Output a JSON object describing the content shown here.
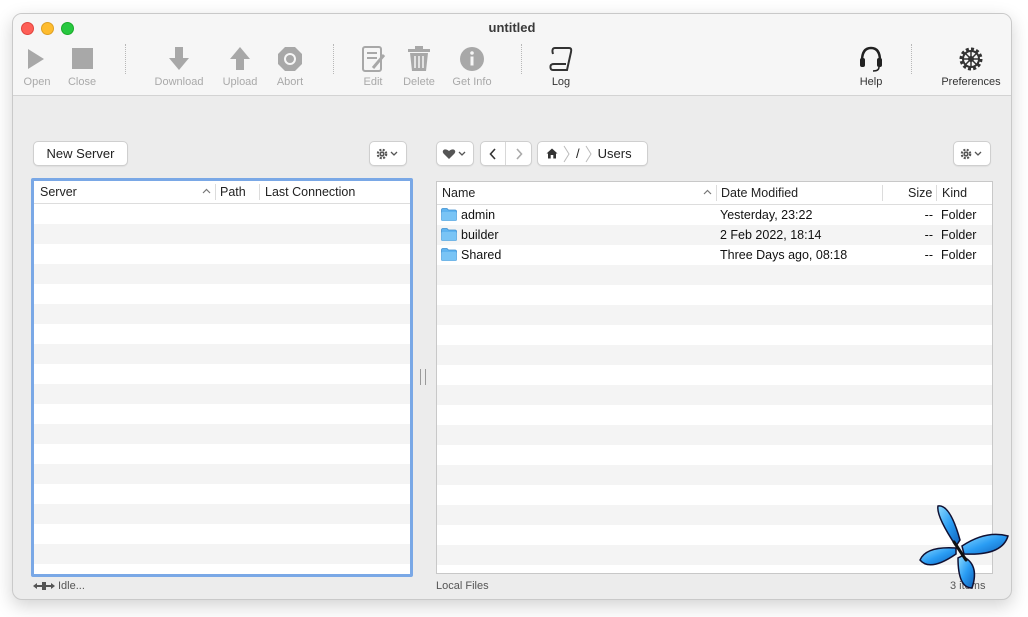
{
  "window": {
    "title": "untitled"
  },
  "toolbar": {
    "open": "Open",
    "close": "Close",
    "download": "Download",
    "upload": "Upload",
    "abort": "Abort",
    "edit": "Edit",
    "delete": "Delete",
    "get_info": "Get Info",
    "log": "Log",
    "help": "Help",
    "preferences": "Preferences"
  },
  "servers": {
    "new_server_label": "New Server",
    "columns": [
      "Server",
      "Path",
      "Last Connection"
    ],
    "rows": [],
    "status": "Idle..."
  },
  "files": {
    "path": {
      "root": "/",
      "current": "Users"
    },
    "columns": [
      "Name",
      "Date Modified",
      "Size",
      "Kind"
    ],
    "rows": [
      {
        "name": "admin",
        "date": "Yesterday, 23:22",
        "size": "--",
        "kind": "Folder"
      },
      {
        "name": "builder",
        "date": "2 Feb 2022, 18:14",
        "size": "--",
        "kind": "Folder"
      },
      {
        "name": "Shared",
        "date": "Three Days ago, 08:18",
        "size": "--",
        "kind": "Folder"
      }
    ],
    "status_left": "Local Files",
    "status_right": "3 items"
  },
  "colors": {
    "accent_focus": "#7aa8e6",
    "folder": "#5fb4f0",
    "butterfly": "#2a9df4"
  },
  "icons": {
    "open": "play-icon",
    "close": "stop-icon",
    "download": "download-arrow-icon",
    "upload": "upload-arrow-icon",
    "abort": "abort-octagon-icon",
    "edit": "edit-document-icon",
    "delete": "trash-icon",
    "get_info": "info-icon",
    "log": "scroll-icon",
    "help": "headset-icon",
    "preferences": "gear-icon"
  }
}
